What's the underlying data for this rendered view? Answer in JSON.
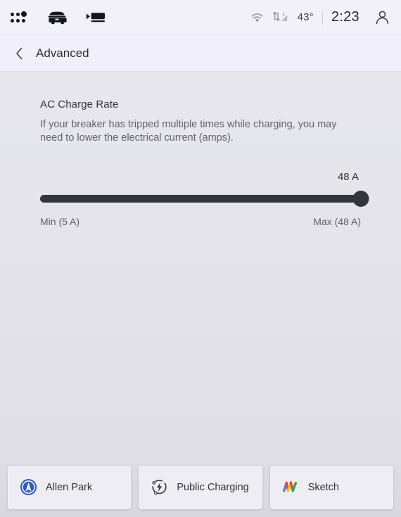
{
  "statusbar": {
    "left_icons": [
      {
        "name": "apps-grid-icon",
        "label": "Apps"
      },
      {
        "name": "car-front-icon",
        "label": "Vehicle"
      },
      {
        "name": "media-screen-icon",
        "label": "Media"
      }
    ],
    "wifi_icon": "wifi-icon",
    "cellular_icon": "cellular-4g-data-icon",
    "cellular_generation": "4",
    "temperature": "43°",
    "time": "2:23",
    "profile_icon": "profile-person-icon"
  },
  "header": {
    "back_icon": "chevron-left-icon",
    "title": "Advanced"
  },
  "main": {
    "section_title": "AC Charge Rate",
    "section_description": "If your breaker has tripped multiple times while charging, you may need to lower the electrical current (amps).",
    "slider": {
      "value_label": "48 A",
      "min_label": "Min (5 A)",
      "max_label": "Max (48 A)",
      "min": 5,
      "max": 48,
      "value": 48,
      "percent": 100,
      "track_color": "#34343c",
      "thumb_color": "#34343c"
    }
  },
  "dock": {
    "cards": [
      {
        "label": "Allen Park",
        "icon": "navigation-arrow-icon",
        "accent": "#2b59d8"
      },
      {
        "label": "Public Charging",
        "icon": "ev-charging-bolt-icon",
        "accent": "#33333d"
      },
      {
        "label": "Sketch",
        "icon": "sketch-multicolor-icon",
        "accent": "#4285f4"
      }
    ]
  }
}
